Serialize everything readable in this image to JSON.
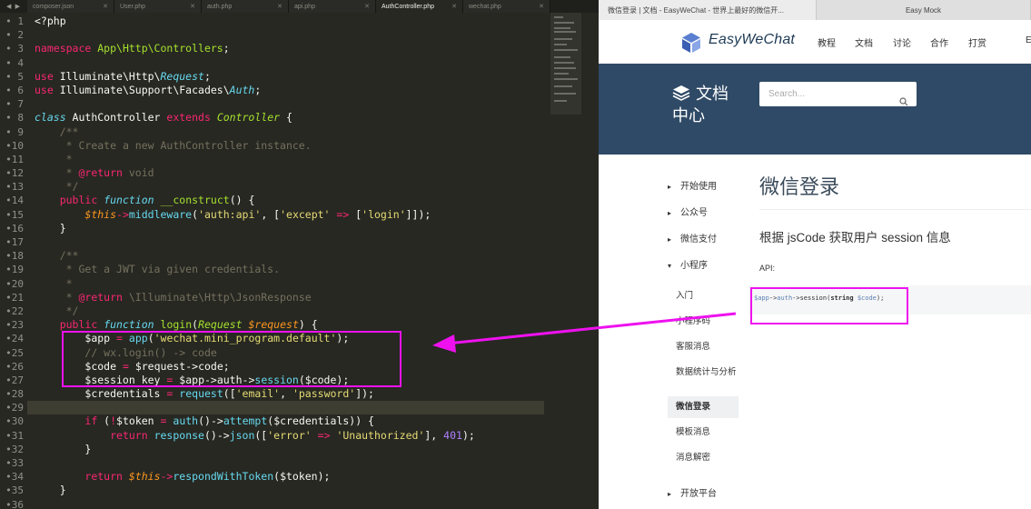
{
  "editor": {
    "tab_nav": "◀ ▶",
    "tabs": [
      {
        "label": "composer.json",
        "close": "✕"
      },
      {
        "label": "User.php",
        "close": "✕"
      },
      {
        "label": "auth.php",
        "close": "✕"
      },
      {
        "label": "api.php",
        "close": "✕"
      },
      {
        "label": "AuthController.php",
        "close": "✕"
      },
      {
        "label": "wechat.php",
        "close": "✕"
      }
    ],
    "line_numbers": [
      "• 1",
      "• 2",
      "• 3",
      "• 4",
      "• 5",
      "• 6",
      "• 7",
      "• 8",
      "• 9",
      "•10",
      "•11",
      "•12",
      "•13",
      "•14",
      "•15",
      "•16",
      "•17",
      "•18",
      "•19",
      "•20",
      "•21",
      "•22",
      "•23",
      "•24",
      "•25",
      "•26",
      "•27",
      "•28",
      "•29",
      "•30",
      "•31",
      "•32",
      "•33",
      "•34",
      "•35",
      "•36"
    ],
    "code": {
      "l1_open": "<?php",
      "l3_kw": "namespace",
      "l3_ns": "App\\Http\\Controllers",
      "l3_end": ";",
      "l5_kw": "use",
      "l5_path": " Illuminate\\Http\\",
      "l5_cls": "Request",
      "l5_end": ";",
      "l6_kw": "use",
      "l6_path": " Illuminate\\Support\\Facades\\",
      "l6_cls": "Auth",
      "l6_end": ";",
      "l8_kw": "class",
      "l8_name": " AuthController ",
      "l8_ext": "extends",
      "l8_parent": "Controller",
      "l8_brace": " {",
      "l9": "/**",
      "l10": " * Create a new AuthController instance.",
      "l11": " *",
      "l12_a": " * ",
      "l12_tag": "@return",
      "l12_b": " void",
      "l13": " */",
      "l14_pub": "public",
      "l14_fn": "function",
      "l14_name": "__construct",
      "l14_rest": "() {",
      "l15_this": "$this",
      "l15_arrow": "->",
      "l15_mw": "middleware",
      "l15_p1": "(",
      "l15_s1": "'auth:api'",
      "l15_p2": ", [",
      "l15_s2": "'except'",
      "l15_fat": "=>",
      "l15_p3": "[",
      "l15_s3": "'login'",
      "l15_p4": "]]);",
      "l16": "}",
      "l18": "/**",
      "l19": " * Get a JWT via given credentials.",
      "l20": " *",
      "l21_a": " * ",
      "l21_tag": "@return",
      "l21_b": " \\Illuminate\\Http\\JsonResponse",
      "l22": " */",
      "l23_pub": "public",
      "l23_fn": "function",
      "l23_name": "login",
      "l23_p1": "(",
      "l23_type": "Request",
      "l23_var": "$request",
      "l23_p2": ") {",
      "l24_var": "$app",
      "l24_eq": "=",
      "l24_fn": "app",
      "l24_p1": "(",
      "l24_s": "'wechat.mini_program.default'",
      "l24_p2": ");",
      "l25": "// wx.login() -> code",
      "l26_var": "$code",
      "l26_eq": "=",
      "l26_rest": "$request->code;",
      "l27_var": "$session_key",
      "l27_eq": "=",
      "l27_a": "$app->auth->",
      "l27_fn": "session",
      "l27_b": "($code);",
      "l28_var": "$credentials",
      "l28_eq": "=",
      "l28_fn": "request",
      "l28_p1": "([",
      "l28_s1": "'email'",
      "l28_c": ", ",
      "l28_s2": "'password'",
      "l28_p2": "]);",
      "l30_if": "if",
      "l30_p1": " (",
      "l30_not": "!",
      "l30_tok": "$token",
      "l30_eq": "=",
      "l30_auth": "auth",
      "l30_mid": "()->",
      "l30_att": "attempt",
      "l30_end": "($credentials)) {",
      "l31_ret": "return",
      "l31_resp": "response",
      "l31_mid": "()->",
      "l31_json": "json",
      "l31_p1": "([",
      "l31_s1": "'error'",
      "l31_fat": "=>",
      "l31_s2": "'Unauthorized'",
      "l31_c": "], ",
      "l31_num": "401",
      "l31_end": ");",
      "l32": "}",
      "l34_ret": "return",
      "l34_this": "$this",
      "l34_arrow": "->",
      "l34_fn": "respondWithToken",
      "l34_end": "($token);",
      "l35": "}"
    }
  },
  "browser": {
    "tabs": [
      "微信登录 | 文档 - EasyWeChat - 世界上最好的微信开...",
      "Easy Mock"
    ],
    "brand": "EasyWeChat",
    "nav": [
      "教程",
      "文档",
      "讨论",
      "合作",
      "打赏",
      "E"
    ],
    "hero_title": [
      "文档",
      "中心"
    ],
    "search_placeholder": "Search...",
    "sidebar": {
      "sections": [
        {
          "label": "开始使用",
          "arrow": "▸"
        },
        {
          "label": "公众号",
          "arrow": "▸"
        },
        {
          "label": "微信支付",
          "arrow": "▸"
        },
        {
          "label": "小程序",
          "arrow": "▾"
        }
      ],
      "sub_items": [
        "入门",
        "小程序码",
        "客服消息",
        "数据统计与分析",
        "微信登录",
        "模板消息",
        "消息解密"
      ],
      "active_item": "微信登录",
      "last_section": {
        "label": "开放平台",
        "arrow": "▸"
      }
    },
    "page_title": "微信登录",
    "section_title": "根据 jsCode 获取用户 session 信息",
    "api_label": "API:",
    "code_snippet": {
      "var1": "$app",
      "op1": "->",
      "prop": "auth",
      "op2": "->",
      "fn": "session(",
      "kw": "string",
      "var2": "$code",
      "end": ");"
    }
  },
  "colors": {
    "editor_bg": "#272822",
    "hero_bg": "#2f4a66",
    "highlight": "#ee11ee",
    "keyword": "#f92672",
    "string": "#e6db74",
    "comment": "#75715e"
  }
}
